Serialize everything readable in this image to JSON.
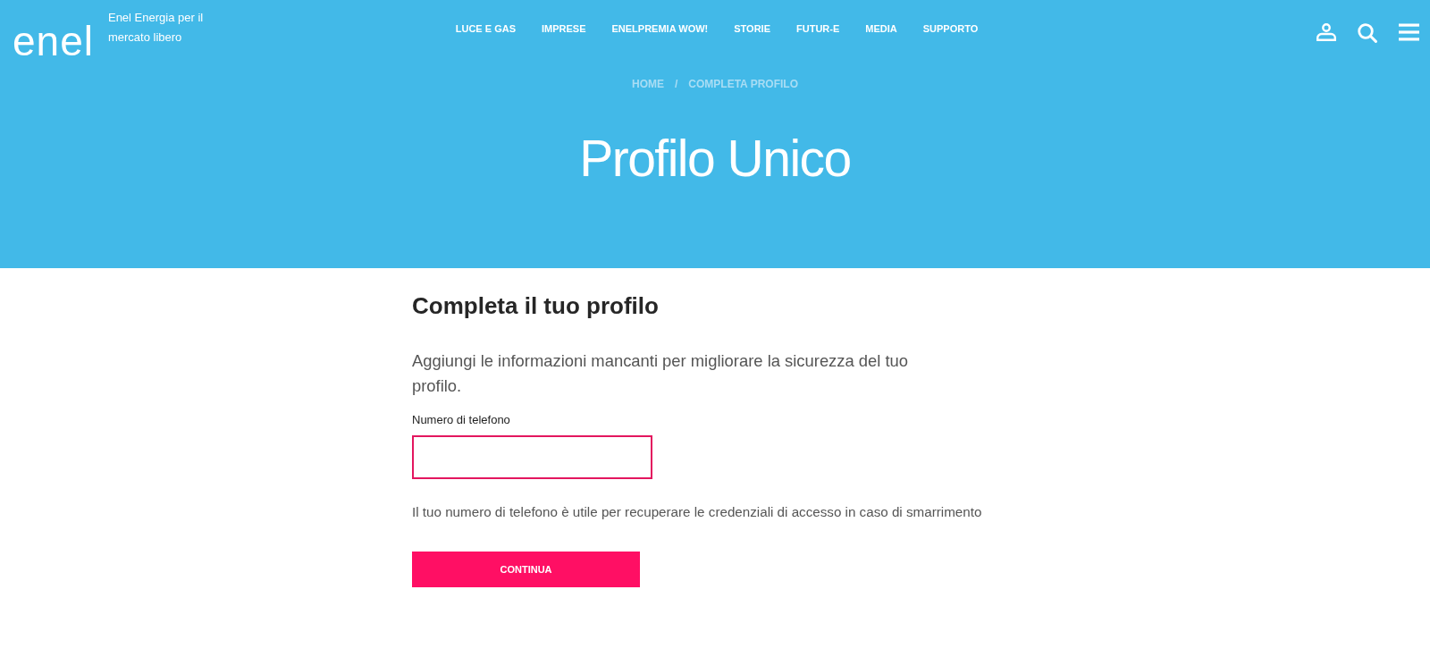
{
  "header": {
    "logo": "enel",
    "tagline": "Enel Energia per il mercato libero",
    "nav": [
      {
        "label": "LUCE E GAS"
      },
      {
        "label": "IMPRESE"
      },
      {
        "label": "ENELPREMIA WOW!"
      },
      {
        "label": "STORIE"
      },
      {
        "label": "FUTUR-E"
      },
      {
        "label": "MEDIA"
      },
      {
        "label": "SUPPORTO"
      }
    ],
    "actions": [
      {
        "kind": "account"
      },
      {
        "kind": "search"
      },
      {
        "kind": "menu"
      }
    ],
    "breadcrumb": {
      "separator": "/",
      "items": [
        {
          "label": "HOME"
        },
        {
          "label": "COMPLETA PROFILO"
        }
      ]
    },
    "title": "Profilo Unico"
  },
  "form": {
    "heading": "Completa il tuo profilo",
    "intro": "Aggiungi le informazioni mancanti per migliorare la sicurezza del tuo profilo.",
    "field": {
      "label": "Numero di telefono"
    },
    "hint": "Il tuo numero di telefono è utile per recuperare le credenziali di accesso in caso di smarrimento",
    "button": "CONTINUA"
  }
}
